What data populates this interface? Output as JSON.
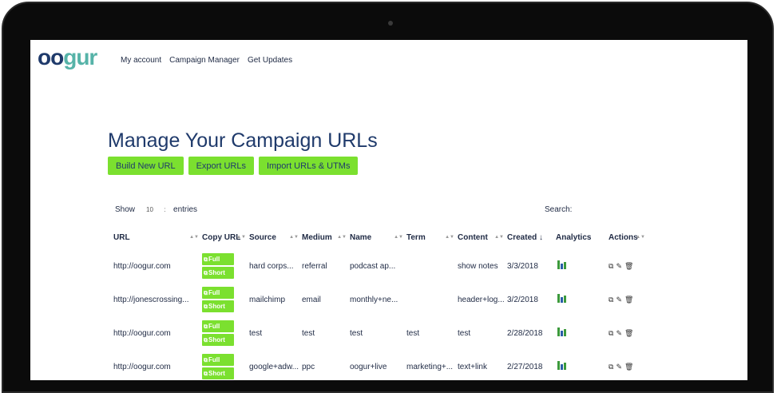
{
  "brand": {
    "logo_text_a": "oo",
    "logo_text_b": "g",
    "logo_text_c": "ur"
  },
  "nav": [
    "My account",
    "Campaign Manager",
    "Get Updates"
  ],
  "page_title": "Manage Your Campaign URLs",
  "buttons": [
    "Build New URL",
    "Export URLs",
    "Import URLs & UTMs"
  ],
  "show": {
    "label": "Show",
    "value": "10",
    "suffix": "entries"
  },
  "search_label": "Search:",
  "columns": [
    "URL",
    "Copy URL",
    "Source",
    "Medium",
    "Name",
    "Term",
    "Content",
    "Created",
    "Analytics",
    "Actions"
  ],
  "pill_full": "Full",
  "pill_short": "Short",
  "rows": [
    {
      "url": "http://oogur.com",
      "source": "hard corps...",
      "medium": "referral",
      "name": "podcast ap...",
      "term": "",
      "content": "show notes",
      "created": "3/3/2018"
    },
    {
      "url": "http://jonescrossing...",
      "source": "mailchimp",
      "medium": "email",
      "name": "monthly+ne...",
      "term": "",
      "content": "header+log...",
      "created": "3/2/2018"
    },
    {
      "url": "http://oogur.com",
      "source": "test",
      "medium": "test",
      "name": "test",
      "term": "test",
      "content": "test",
      "created": "2/28/2018"
    },
    {
      "url": "http://oogur.com",
      "source": "google+adw...",
      "medium": "ppc",
      "name": "oogur+live",
      "term": "marketing+...",
      "content": "text+link",
      "created": "2/27/2018"
    }
  ],
  "colors": {
    "accent": "#7be02f",
    "title": "#1f3a6b",
    "logo_teal": "#56b3a8"
  }
}
